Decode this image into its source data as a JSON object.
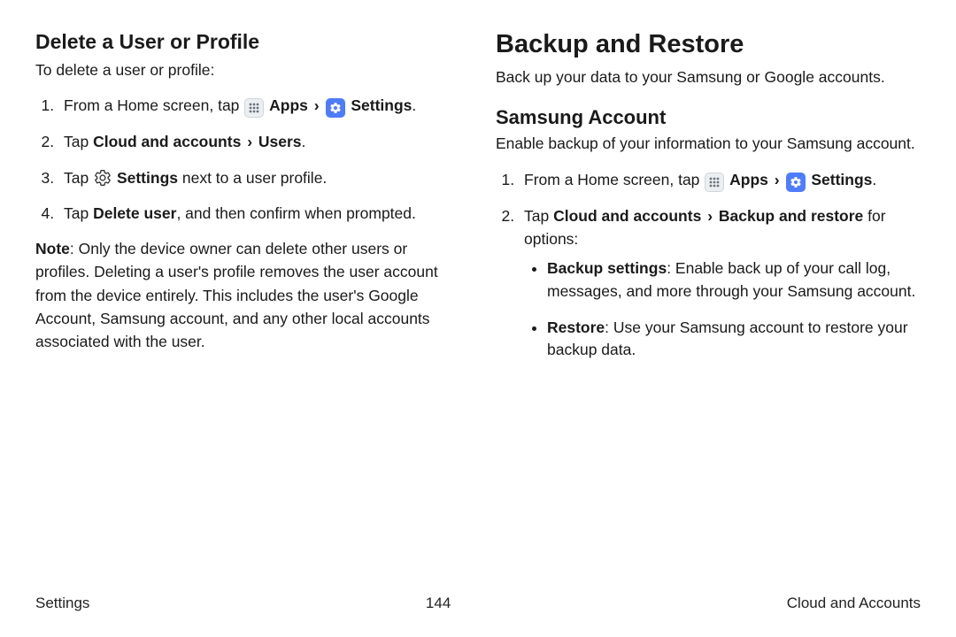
{
  "left": {
    "title": "Delete a User or Profile",
    "intro": "To delete a user or profile:",
    "step1_a": "From a Home screen, tap ",
    "apps_label": "Apps",
    "settings_label": "Settings",
    "step2_a": "Tap ",
    "step2_b": "Cloud and accounts",
    "step2_c": "Users",
    "step2_d": ".",
    "step3_a": "Tap ",
    "step3_b": "Settings",
    "step3_c": " next to a user profile.",
    "step4_a": "Tap ",
    "step4_b": "Delete user",
    "step4_c": ", and then confirm when prompted.",
    "note_label": "Note",
    "note_body": ": Only the device owner can delete other users or profiles. Deleting a user's profile removes the user account from the device entirely. This includes the user's Google Account, Samsung account, and any other local accounts associated with the user."
  },
  "right": {
    "big_title": "Backup and Restore",
    "big_intro": "Back up your data to your Samsung or Google accounts.",
    "sub_title": "Samsung Account",
    "sub_intro": "Enable backup of your information to your Samsung account.",
    "step1_a": "From a Home screen, tap ",
    "apps_label": "Apps",
    "settings_label": "Settings",
    "step2_a": "Tap ",
    "step2_b": "Cloud and accounts",
    "step2_c": "Backup and restore",
    "step2_d": " for options:",
    "bullet1_a": "Backup settings",
    "bullet1_b": ": Enable back up of your call log, messages, and more through your Samsung account.",
    "bullet2_a": "Restore",
    "bullet2_b": ": Use your Samsung account to restore your backup data."
  },
  "footer": {
    "left": "Settings",
    "center": "144",
    "right": "Cloud and Accounts"
  }
}
